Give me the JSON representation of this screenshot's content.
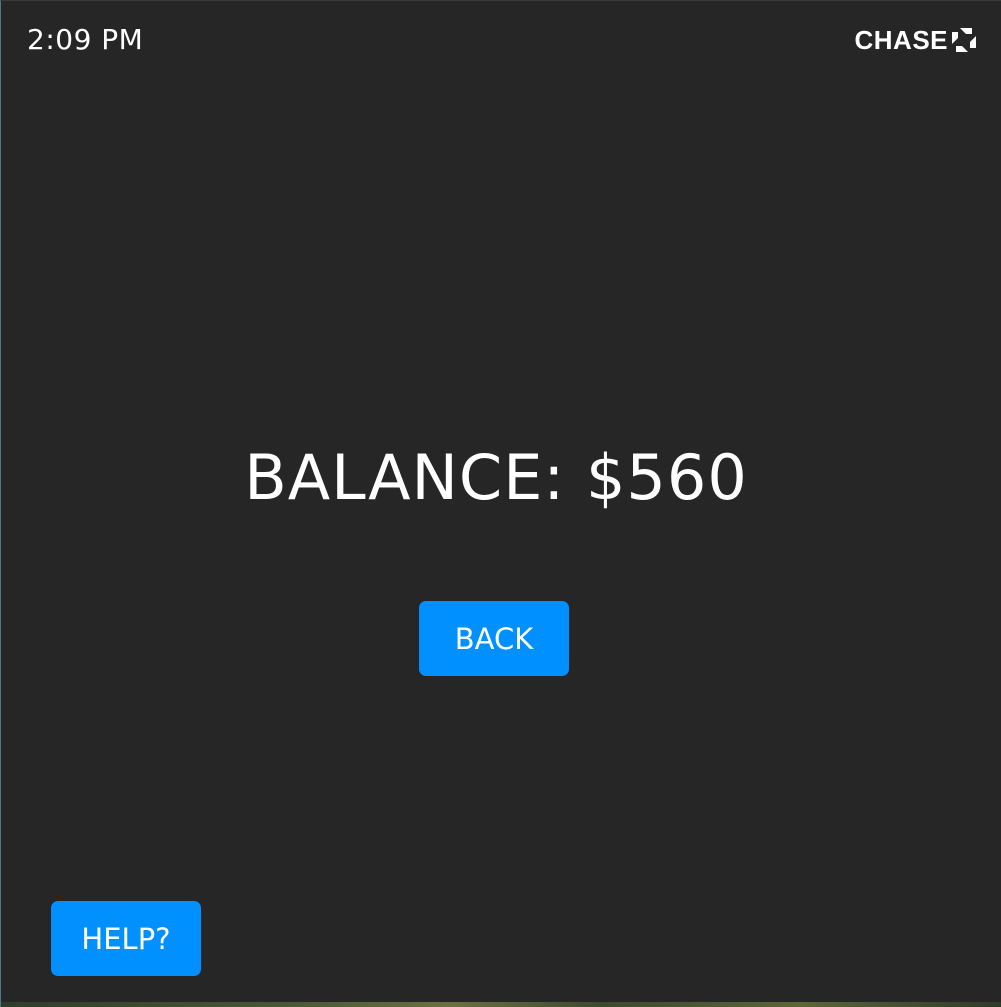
{
  "status_bar": {
    "time": "2:09 PM",
    "brand_name": "CHASE",
    "brand_icon": "chase-octagon-logo"
  },
  "main": {
    "balance_text": "BALANCE: $560",
    "back_label": "BACK"
  },
  "footer": {
    "help_label": "HELP?"
  },
  "colors": {
    "background": "#262626",
    "button": "#0090ff",
    "text": "#ffffff"
  }
}
